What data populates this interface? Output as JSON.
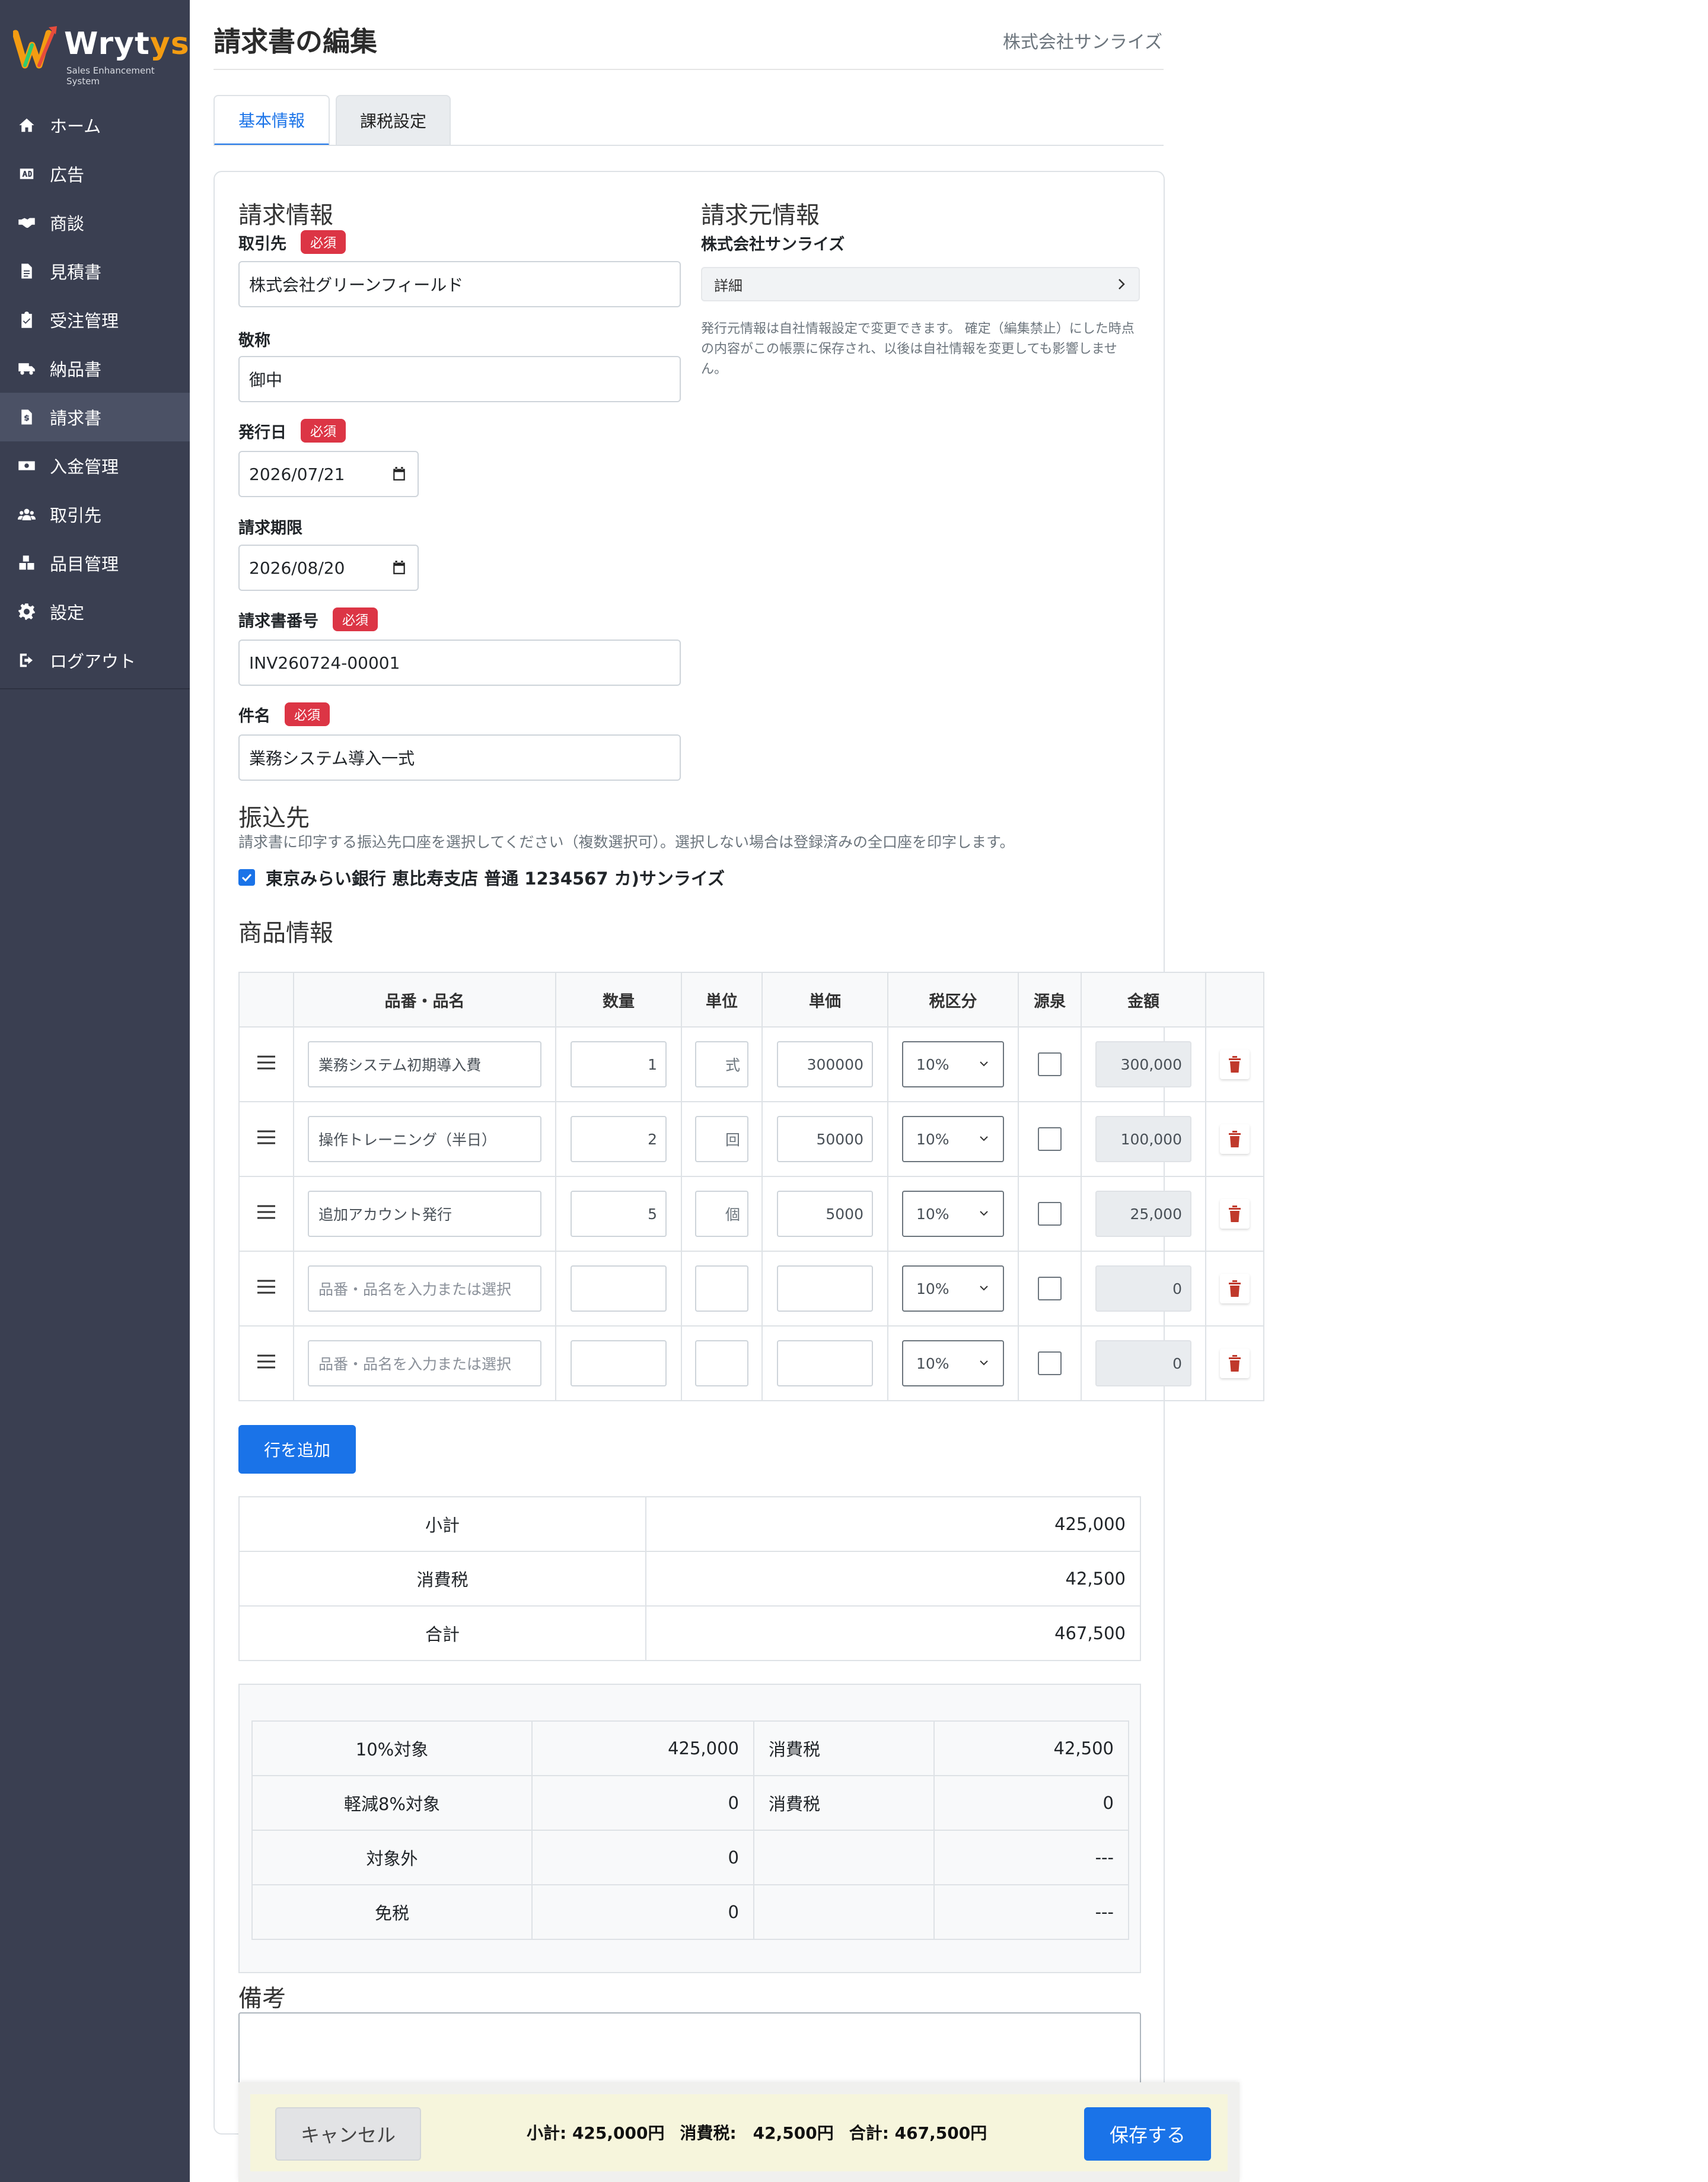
{
  "app": {
    "logo_main": "Wryt",
    "logo_accent": "ys",
    "logo_sub": "Sales Enhancement System",
    "page_title": "請求書の編集",
    "company": "株式会社サンライズ"
  },
  "sidebar": {
    "items": [
      {
        "label": "ホーム",
        "icon": "home-icon"
      },
      {
        "label": "広告",
        "icon": "ad-icon"
      },
      {
        "label": "商談",
        "icon": "handshake-icon"
      },
      {
        "label": "見積書",
        "icon": "document-icon"
      },
      {
        "label": "受注管理",
        "icon": "clipboard-check-icon"
      },
      {
        "label": "納品書",
        "icon": "truck-icon"
      },
      {
        "label": "請求書",
        "icon": "invoice-icon",
        "active": true
      },
      {
        "label": "入金管理",
        "icon": "money-icon"
      },
      {
        "label": "取引先",
        "icon": "users-icon"
      },
      {
        "label": "品目管理",
        "icon": "boxes-icon"
      },
      {
        "label": "設定",
        "icon": "gear-icon"
      },
      {
        "label": "ログアウト",
        "icon": "logout-icon"
      }
    ]
  },
  "tabs": [
    {
      "label": "基本情報",
      "active": true
    },
    {
      "label": "課税設定",
      "active": false
    }
  ],
  "billing": {
    "section_title": "請求情報",
    "required_label": "必須",
    "client_label": "取引先",
    "client_value": "株式会社グリーンフィールド",
    "honorific_label": "敬称",
    "honorific_value": "御中",
    "issue_date_label": "発行日",
    "issue_date_value": "2026/07/21",
    "due_date_label": "請求期限",
    "due_date_value": "2026/08/20",
    "number_label": "請求書番号",
    "number_value": "INV260724-00001",
    "subject_label": "件名",
    "subject_value": "業務システム導入一式"
  },
  "issuer": {
    "section_title": "請求元情報",
    "company": "株式会社サンライズ",
    "details_label": "詳細",
    "note": "発行元情報は自社情報設定で変更できます。 確定（編集禁止）にした時点の内容がこの帳票に保存され、以後は自社情報を変更しても影響しません。"
  },
  "bank": {
    "section_title": "振込先",
    "description": "請求書に印字する振込先口座を選択してください（複数選択可）。選択しない場合は登録済みの全口座を印字します。",
    "account": "東京みらい銀行 恵比寿支店 普通 1234567 カ)サンライズ",
    "checked": true
  },
  "products": {
    "section_title": "商品情報",
    "headers": [
      "品番・品名",
      "数量",
      "単位",
      "単価",
      "税区分",
      "源泉",
      "金額"
    ],
    "name_placeholder": "品番・品名を入力または選択",
    "rows": [
      {
        "name": "業務システム初期導入費",
        "qty": "1",
        "unit": "式",
        "price": "300000",
        "tax": "10%",
        "withholding": false,
        "amount": "300,000"
      },
      {
        "name": "操作トレーニング（半日）",
        "qty": "2",
        "unit": "回",
        "price": "50000",
        "tax": "10%",
        "withholding": false,
        "amount": "100,000"
      },
      {
        "name": "追加アカウント発行",
        "qty": "5",
        "unit": "個",
        "price": "5000",
        "tax": "10%",
        "withholding": false,
        "amount": "25,000"
      },
      {
        "name": "",
        "qty": "",
        "unit": "",
        "price": "",
        "tax": "10%",
        "withholding": false,
        "amount": "0"
      },
      {
        "name": "",
        "qty": "",
        "unit": "",
        "price": "",
        "tax": "10%",
        "withholding": false,
        "amount": "0"
      }
    ],
    "add_row_label": "行を追加"
  },
  "totals": {
    "subtotal_label": "小計",
    "subtotal": "425,000",
    "tax_label": "消費税",
    "tax": "42,500",
    "total_label": "合計",
    "total": "467,500"
  },
  "tax_breakdown": [
    {
      "label": "10%対象",
      "amount": "425,000",
      "tax_label": "消費税",
      "tax": "42,500"
    },
    {
      "label": "軽減8%対象",
      "amount": "0",
      "tax_label": "消費税",
      "tax": "0"
    },
    {
      "label": "対象外",
      "amount": "0",
      "tax_label": "",
      "tax": "---"
    },
    {
      "label": "免税",
      "amount": "0",
      "tax_label": "",
      "tax": "---"
    }
  ],
  "remarks": {
    "title": "備考",
    "value": ""
  },
  "footer": {
    "cancel_label": "キャンセル",
    "summary_subtotal": "小計: 425,000円",
    "summary_tax": "消費税:　42,500円",
    "summary_total": "合計: 467,500円",
    "save_label": "保存する"
  },
  "colors": {
    "sidebar_bg": "#3a3f51",
    "accent": "#1a73e8",
    "required_badge": "#dc3545",
    "delete_icon": "#c0392b",
    "footer_bg": "#f6f5dc"
  }
}
